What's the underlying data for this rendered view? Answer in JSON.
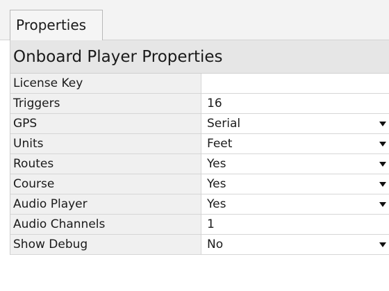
{
  "tab": {
    "label": "Properties"
  },
  "category": {
    "title": "Onboard Player Properties"
  },
  "properties": [
    {
      "name": "License Key",
      "value": "",
      "dropdown": false
    },
    {
      "name": "Triggers",
      "value": "16",
      "dropdown": false
    },
    {
      "name": "GPS",
      "value": "Serial",
      "dropdown": true
    },
    {
      "name": "Units",
      "value": "Feet",
      "dropdown": true
    },
    {
      "name": "Routes",
      "value": "Yes",
      "dropdown": true
    },
    {
      "name": "Course",
      "value": "Yes",
      "dropdown": true
    },
    {
      "name": "Audio Player",
      "value": "Yes",
      "dropdown": true
    },
    {
      "name": "Audio Channels",
      "value": "1",
      "dropdown": false
    },
    {
      "name": "Show Debug",
      "value": "No",
      "dropdown": true
    }
  ],
  "icons": {
    "dropdown": "chevron-down-icon"
  }
}
